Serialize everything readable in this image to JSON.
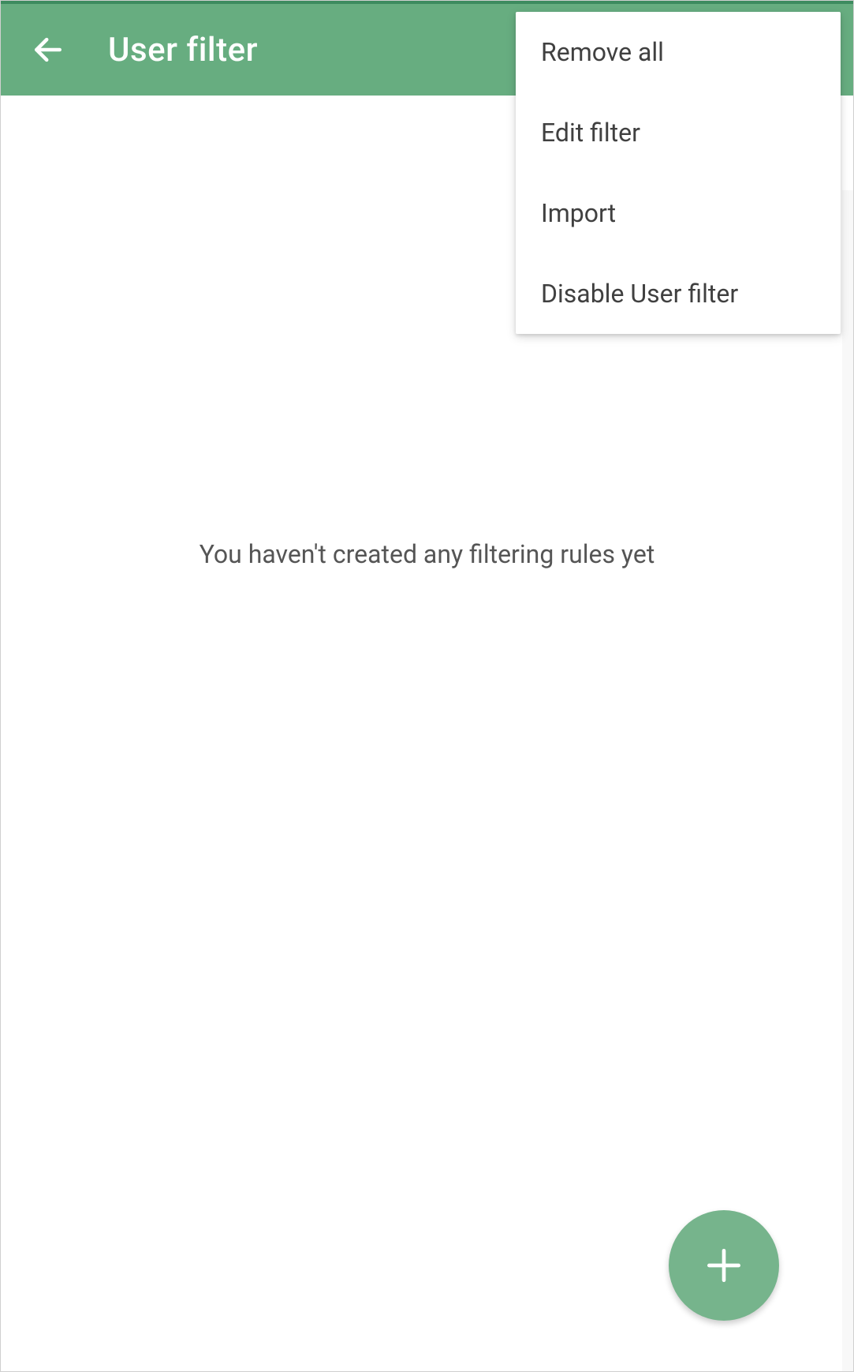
{
  "header": {
    "title": "User filter"
  },
  "menu": {
    "items": [
      {
        "label": "Remove all"
      },
      {
        "label": "Edit filter"
      },
      {
        "label": "Import"
      },
      {
        "label": "Disable User filter"
      }
    ]
  },
  "empty_state": {
    "message": "You haven't created any filtering rules yet"
  },
  "colors": {
    "primary": "#67ad80",
    "primary_dark": "#3d8b5f",
    "fab": "#76b48c"
  }
}
